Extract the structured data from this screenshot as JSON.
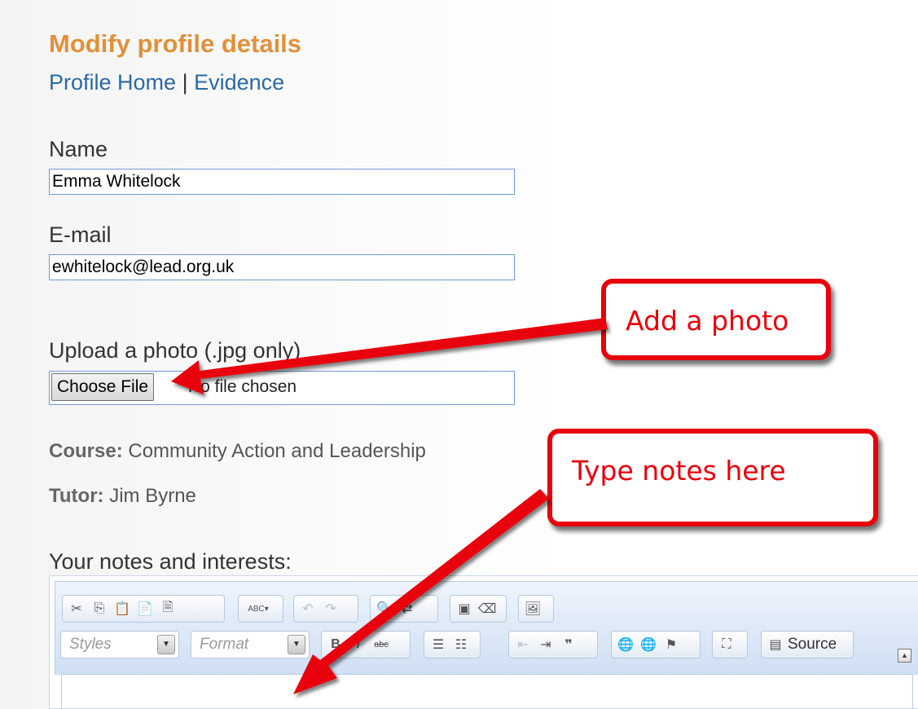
{
  "page": {
    "title": "Modify profile details",
    "nav": {
      "home": "Profile Home",
      "separator": "|",
      "evidence": "Evidence"
    }
  },
  "form": {
    "name_label": "Name",
    "name_value": "Emma Whitelock",
    "email_label": "E-mail",
    "email_value": "ewhitelock@lead.org.uk",
    "photo_label": "Upload a photo (.jpg only)",
    "choose_file_label": "Choose File",
    "no_file_text": "No file chosen",
    "course_label": "Course:",
    "course_value": "Community Action and Leadership",
    "tutor_label": "Tutor:",
    "tutor_value": "Jim Byrne",
    "notes_label": "Your notes and interests:"
  },
  "editor": {
    "styles_placeholder": "Styles",
    "format_placeholder": "Format",
    "source_label": "Source",
    "bold": "B",
    "italic": "I",
    "strike": "abc",
    "spell": "ABC"
  },
  "annotations": {
    "callout_photo": "Add a photo",
    "callout_notes": "Type notes here",
    "color": "#e8000b"
  }
}
